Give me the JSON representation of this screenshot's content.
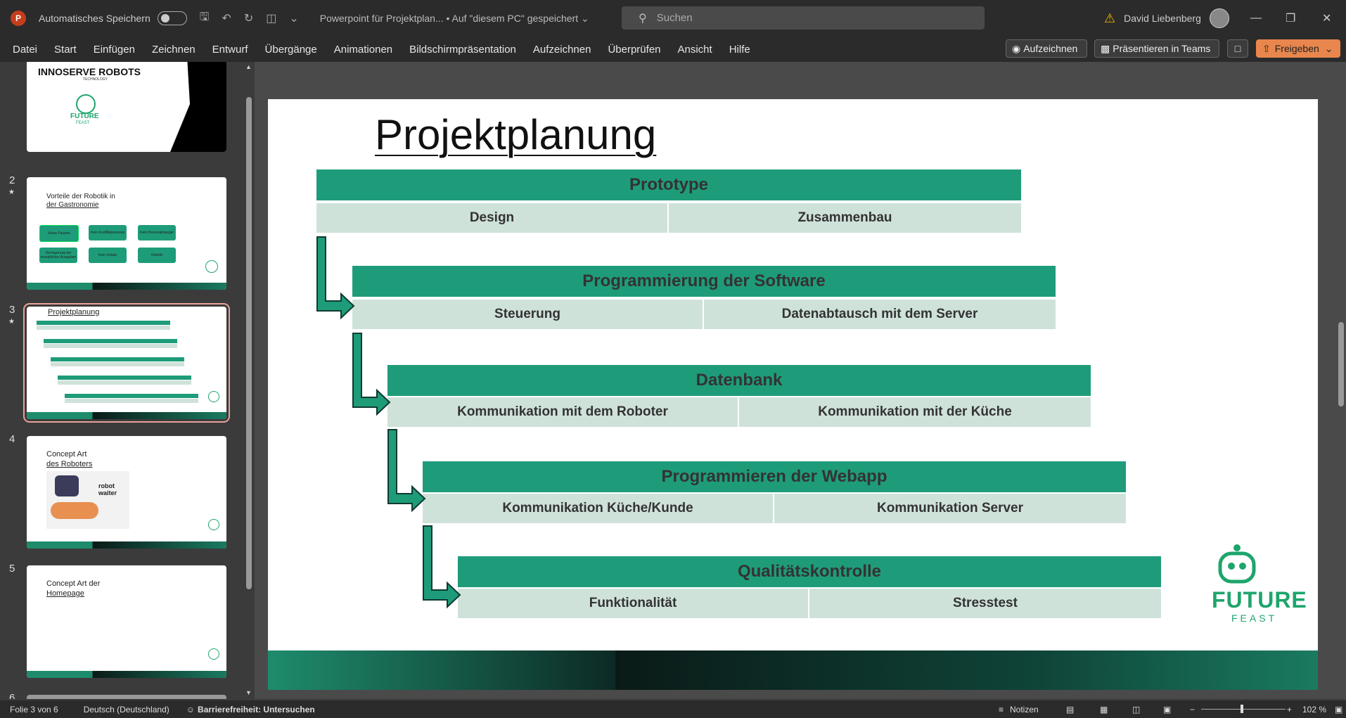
{
  "titlebar": {
    "app_icon": "P",
    "autosave_label": "Automatisches Speichern",
    "doc_title": "Powerpoint für Projektplan... • Auf \"diesem PC\" gespeichert",
    "search_placeholder": "Suchen",
    "user_name": "David Liebenberg"
  },
  "menu": {
    "items": [
      "Datei",
      "Start",
      "Einfügen",
      "Zeichnen",
      "Entwurf",
      "Übergänge",
      "Animationen",
      "Bildschirmpräsentation",
      "Aufzeichnen",
      "Überprüfen",
      "Ansicht",
      "Hilfe"
    ],
    "record_label": "Aufzeichnen",
    "teams_label": "Präsentieren in Teams",
    "share_label": "Freigeben"
  },
  "thumbnails": [
    {
      "num": "",
      "brand_title": "INNOSERVE ROBOTS",
      "brand_sub": "TECHNOLOGY",
      "logo_top": "FUTURE",
      "logo_bottom": "FEAST"
    },
    {
      "num": "2",
      "title_line1": "Vorteile der Robotik in",
      "title_line2": "der Gastronomie",
      "boxes": [
        "Keine Pausen",
        "Kein Konfliktpotenzial",
        "Kein Personalmangel",
        "Verringerung der monatlichen Ausgaben",
        "Kein Urlaub",
        "Vorteile"
      ]
    },
    {
      "num": "3",
      "title": "Projektplanung"
    },
    {
      "num": "4",
      "title_line1": "Concept Art",
      "title_line2": "des Roboters",
      "robot_text": "robot waiter"
    },
    {
      "num": "5",
      "title_line1": "Concept Art der",
      "title_line2": "Homepage"
    },
    {
      "num": "6"
    }
  ],
  "slide": {
    "title": "Projektplanung",
    "blocks": [
      {
        "head": "Prototype",
        "left": "Design",
        "right": "Zusammenbau"
      },
      {
        "head": "Programmierung der Software",
        "left": "Steuerung",
        "right": "Datenabtausch mit dem Server"
      },
      {
        "head": "Datenbank",
        "left": "Kommunikation mit dem Roboter",
        "right": "Kommunikation mit der Küche"
      },
      {
        "head": "Programmieren der Webapp",
        "left": "Kommunikation Küche/Kunde",
        "right": "Kommunikation Server"
      },
      {
        "head": "Qualitätskontrolle",
        "left": "Funktionalität",
        "right": "Stresstest"
      }
    ],
    "logo_top": "FUTURE",
    "logo_bottom": "FEAST"
  },
  "status": {
    "slide_info": "Folie 3 von 6",
    "language": "Deutsch (Deutschland)",
    "accessibility": "Barrierefreiheit: Untersuchen",
    "notes": "Notizen",
    "zoom": "102 %"
  },
  "colors": {
    "accent_green": "#1e9c7a",
    "light_green": "#cfe2da",
    "share_orange": "#e8864d"
  }
}
